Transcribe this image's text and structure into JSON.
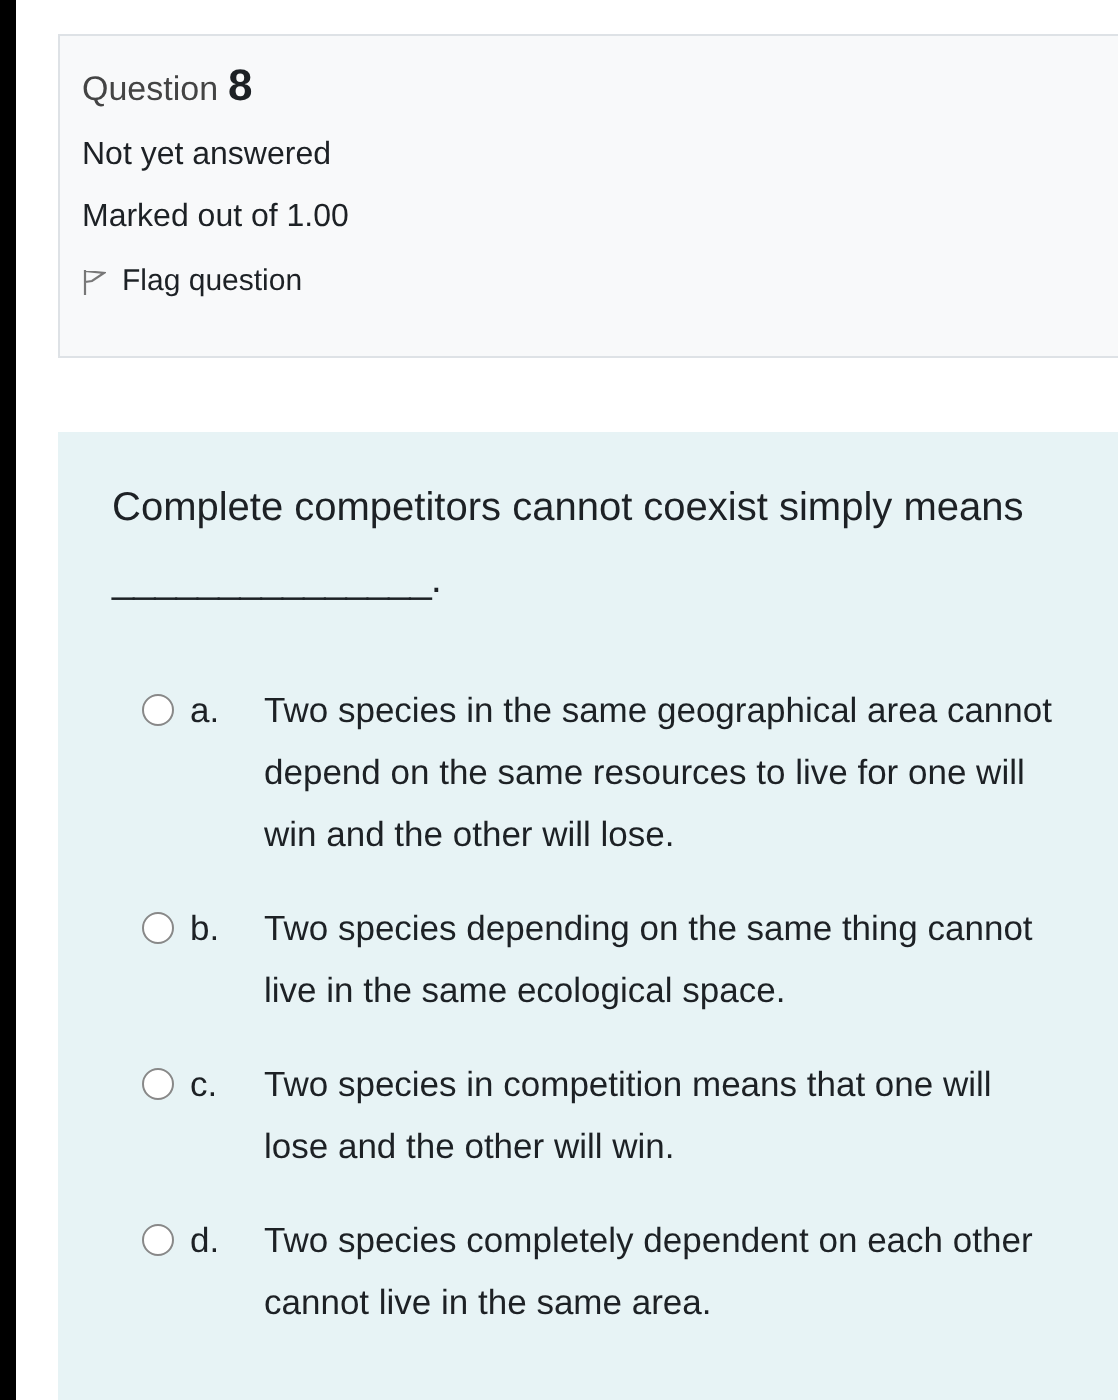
{
  "info": {
    "label": "Question",
    "number": "8",
    "status": "Not yet answered",
    "marks": "Marked out of 1.00",
    "flag": {
      "label": "Flag question",
      "flagged": false
    }
  },
  "question": {
    "text": "Complete competitors cannot coexist simply means",
    "blank": "_______________",
    "end": ".",
    "options": [
      {
        "letter": "a.",
        "text": "Two species in the same geographical area cannot depend on the same resources to live for one will win and the other will lose.",
        "selected": false
      },
      {
        "letter": "b.",
        "text": "Two species depending on the same thing cannot live in the same ecological space.",
        "selected": false
      },
      {
        "letter": "c.",
        "text": "Two species in competition means that one will lose and the other will win.",
        "selected": false
      },
      {
        "letter": "d.",
        "text": "Two species completely dependent on each other cannot live in the same area.",
        "selected": false
      }
    ]
  }
}
